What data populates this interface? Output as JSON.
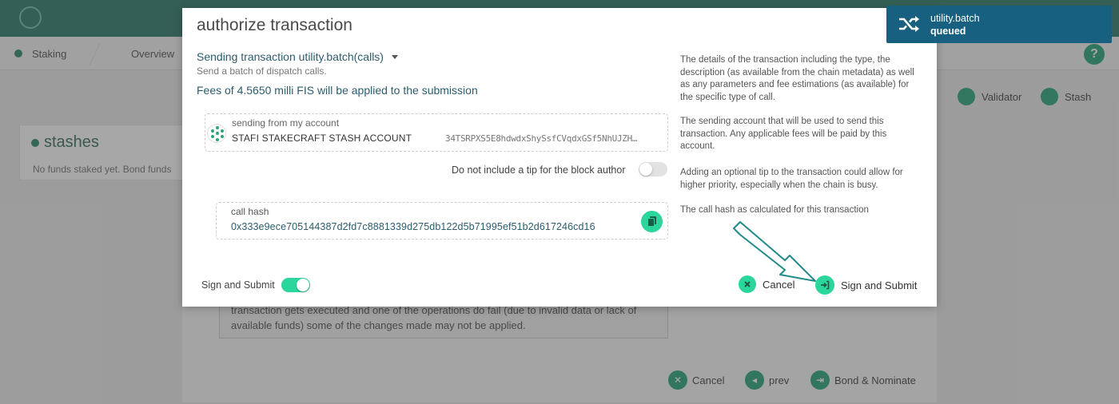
{
  "background": {
    "tabs": [
      "Staking",
      "Overview"
    ],
    "actions": [
      "Validator",
      "Stash"
    ],
    "card_title": "stashes",
    "card_text": "No funds staked yet. Bond funds",
    "warning_lines": [
      "transaction gets executed and one of the operations do fail (due to invalid data or lack of",
      "available funds) some of the changes made may not be applied."
    ],
    "footer_buttons": [
      "Cancel",
      "prev",
      "Bond & Nominate"
    ]
  },
  "modal": {
    "title": "authorize transaction",
    "tx_title": "Sending transaction utility.batch(calls)",
    "tx_subtitle": "Send a batch of dispatch calls.",
    "fees": "Fees of 4.5650 milli FIS will be applied to the submission",
    "account": {
      "label": "sending from my account",
      "name": "STAFI STAKECRAFT STASH ACCOUNT",
      "address": "34TSRPXS5E8hdwdxShySsfCVqdxGSf5NhUJZH…"
    },
    "tip": {
      "label": "Do not include a tip for the block author",
      "enabled": false
    },
    "call_hash": {
      "label": "call hash",
      "value": "0x333e9ece705144387d2fd7c8881339d275db122d5b71995ef51b2d617246cd16"
    },
    "descriptions": {
      "details": "The details of the transaction including the type, the description (as available from the chain metadata) as well as any parameters and fee estimations (as available) for the specific type of call.",
      "account": "The sending account that will be used to send this transaction. Any applicable fees will be paid by this account.",
      "tip": "Adding an optional tip to the transaction could allow for higher priority, especially when the chain is busy.",
      "hash": "The call hash as calculated for this transaction"
    },
    "sign_toggle": {
      "label": "Sign and Submit",
      "enabled": true
    },
    "cancel_label": "Cancel",
    "submit_label": "Sign and Submit"
  },
  "toast": {
    "title": "utility.batch",
    "status": "queued"
  },
  "colors": {
    "accent": "#2ad69c",
    "toast_bg": "#17607f",
    "text_link": "#2c5c6e"
  }
}
